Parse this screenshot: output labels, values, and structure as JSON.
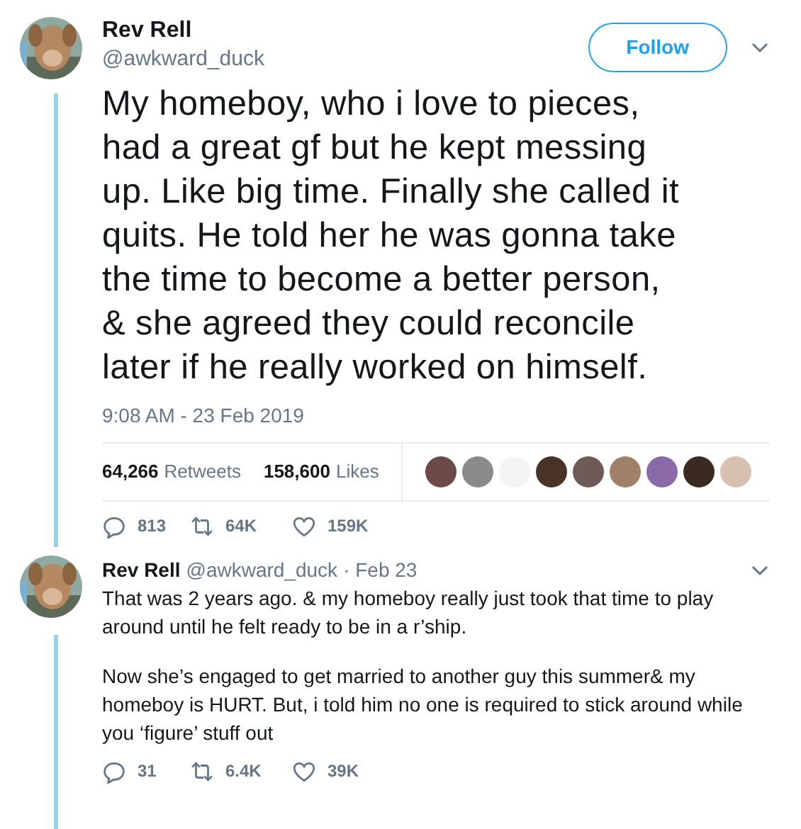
{
  "tweet": {
    "author": {
      "name": "Rev Rell",
      "handle": "@awkward_duck"
    },
    "follow_button": "Follow",
    "text": "My homeboy, who i love to pieces,\nhad a great gf but he kept messing\nup. Like big time. Finally she called it\nquits. He told her he was gonna take\nthe time to become a better person,\n& she agreed they could reconcile\nlater if he really worked on himself.",
    "timestamp": "9:08 AM - 23 Feb 2019",
    "stats": [
      {
        "count": "64,266",
        "label": "Retweets"
      },
      {
        "count": "158,600",
        "label": "Likes"
      }
    ],
    "likers": [
      {
        "color": "#6b4a48"
      },
      {
        "color": "#8a8a8a"
      },
      {
        "color": "#f4f4f4"
      },
      {
        "color": "#4a3228"
      },
      {
        "color": "#6e5a58"
      },
      {
        "color": "#a08068"
      },
      {
        "color": "#8a6aa8"
      },
      {
        "color": "#3a2a22"
      },
      {
        "color": "#d8c0b0"
      }
    ],
    "actions": [
      {
        "kind": "reply",
        "count": "813"
      },
      {
        "kind": "retweet",
        "count": "64K"
      },
      {
        "kind": "like",
        "count": "159K"
      }
    ]
  },
  "reply": {
    "author": {
      "name": "Rev Rell",
      "handle": "@awkward_duck"
    },
    "date": "· Feb 23",
    "paragraphs": [
      "That was 2 years ago. & my homeboy really just took that time to play\naround until he felt ready to be in a r’ship.",
      "Now she’s engaged to get married to another guy this summer& my\nhomeboy is HURT. But, i told him no one is required to stick around while\nyou ‘figure’ stuff out"
    ],
    "actions": [
      {
        "kind": "reply",
        "count": "31"
      },
      {
        "kind": "retweet",
        "count": "6.4K"
      },
      {
        "kind": "like",
        "count": "39K"
      }
    ]
  }
}
